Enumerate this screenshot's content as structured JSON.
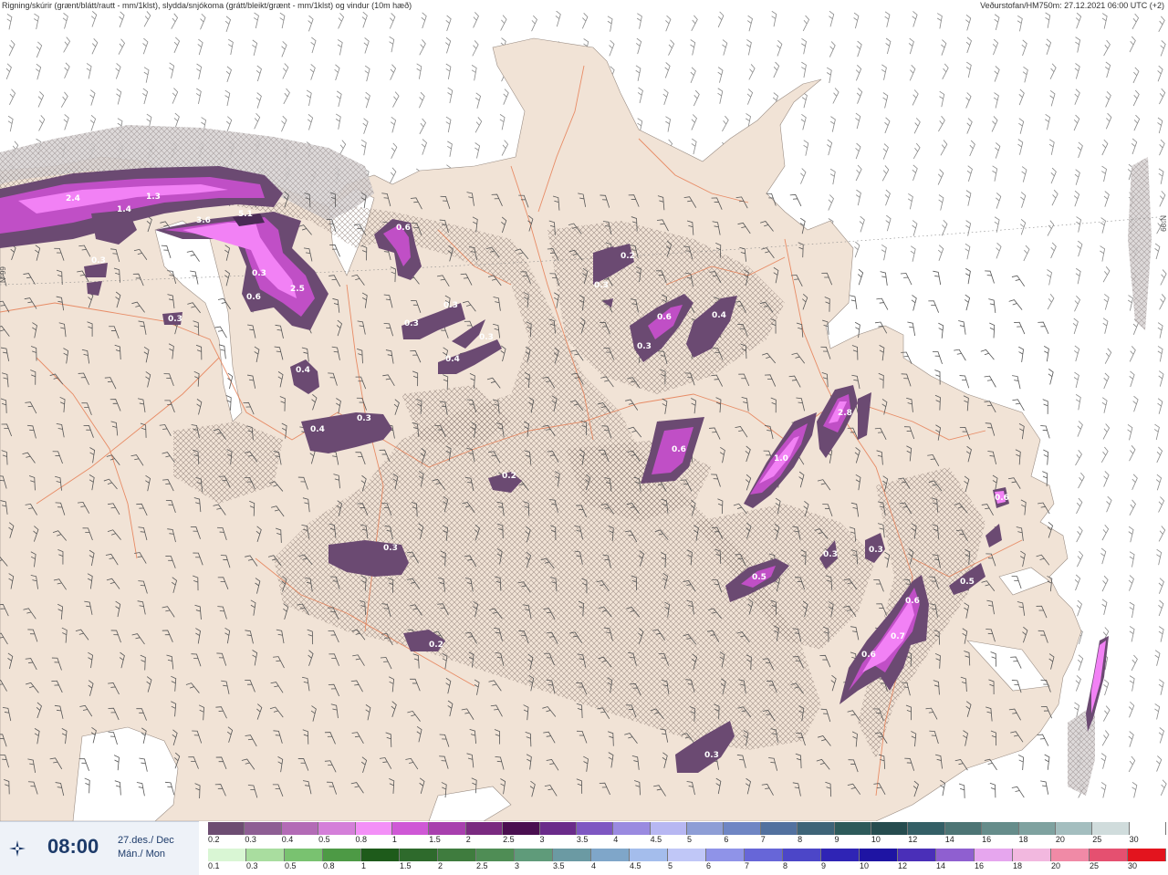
{
  "header": {
    "title": "Rigning/skúrir (grænt/blátt/rautt - mm/1klst), slydda/snjókoma (grátt/bleikt/grænt - mm/1klst) og vindur (10m hæð)",
    "source": "Veðurstofan/HM750m: 27.12.2021 06:00 UTC (+2)"
  },
  "timebox": {
    "icon": "crosshair-star-icon",
    "time": "08:00",
    "date_line1": "27.des./ Dec",
    "date_line2": "Mán./ Mon"
  },
  "map": {
    "lat_label_left": "N°99",
    "lat_label_right": "N°99",
    "colors": {
      "land": "#f1e3d6",
      "sea": "#ffffff",
      "roads": "#e67c52",
      "hatch": "#8b7a73",
      "cell_dark": "#6b4a72",
      "cell_mid": "#c04fc6",
      "cell_bright": "#f281f5"
    },
    "cells": [
      {
        "label": "2.4",
        "value": 2.4
      },
      {
        "label": "1.3",
        "value": 1.3
      },
      {
        "label": "1.4",
        "value": 1.4
      },
      {
        "label": "3.6",
        "value": 3.6
      },
      {
        "label": "5.1",
        "value": 5.1
      },
      {
        "label": "0.3",
        "value": 0.3
      },
      {
        "label": "0.3",
        "value": 0.3
      },
      {
        "label": "2.5",
        "value": 2.5
      },
      {
        "label": "0.6",
        "value": 0.6
      },
      {
        "label": "0.3",
        "value": 0.3
      },
      {
        "label": "0.6",
        "value": 0.6
      },
      {
        "label": "0.3",
        "value": 0.3
      },
      {
        "label": "0.3",
        "value": 0.3
      },
      {
        "label": "0.3",
        "value": 0.3
      },
      {
        "label": "0.4",
        "value": 0.4
      },
      {
        "label": "0.4",
        "value": 0.4
      },
      {
        "label": "0.4",
        "value": 0.4
      },
      {
        "label": "0.3",
        "value": 0.3
      },
      {
        "label": "0.2",
        "value": 0.2
      },
      {
        "label": "0.3",
        "value": 0.3
      },
      {
        "label": "0.6",
        "value": 0.6
      },
      {
        "label": "0.3",
        "value": 0.3
      },
      {
        "label": "0.4",
        "value": 0.4
      },
      {
        "label": "0.6",
        "value": 0.6
      },
      {
        "label": "1.0",
        "value": 1.0
      },
      {
        "label": "2.8",
        "value": 2.8
      },
      {
        "label": "0.2",
        "value": 0.2
      },
      {
        "label": "0.3",
        "value": 0.3
      },
      {
        "label": "0.2",
        "value": 0.2
      },
      {
        "label": "0.5",
        "value": 0.5
      },
      {
        "label": "0.3",
        "value": 0.3
      },
      {
        "label": "0.3",
        "value": 0.3
      },
      {
        "label": "0.6",
        "value": 0.6
      },
      {
        "label": "0.7",
        "value": 0.7
      },
      {
        "label": "0.6",
        "value": 0.6
      },
      {
        "label": "0.5",
        "value": 0.5
      },
      {
        "label": "0.6",
        "value": 0.6
      },
      {
        "label": "0.3",
        "value": 0.3
      }
    ]
  },
  "legend": {
    "snow": {
      "labels": [
        "0.2",
        "0.3",
        "0.4",
        "0.5",
        "0.8",
        "1",
        "1.5",
        "2",
        "2.5",
        "3",
        "3.5",
        "4",
        "4.5",
        "5",
        "6",
        "7",
        "8",
        "9",
        "10",
        "12",
        "14",
        "16",
        "18",
        "20",
        "25",
        "30"
      ],
      "colors": [
        "#6d4d72",
        "#8e5e94",
        "#b36bb6",
        "#d47fd9",
        "#f390f7",
        "#cf58d6",
        "#a83fae",
        "#7a2a80",
        "#4a0f50",
        "#6a2b8a",
        "#7e57c2",
        "#9a8ae0",
        "#b7b7f2",
        "#8e9ed6",
        "#6f86c4",
        "#52719f",
        "#3e6478",
        "#2d5a5a",
        "#264c4f",
        "#345f66",
        "#4d7575",
        "#668d8b",
        "#7fa2a0",
        "#a4bebf",
        "#d0dcdc",
        "#ffffff"
      ]
    },
    "rain": {
      "labels": [
        "0.1",
        "0.3",
        "0.5",
        "0.8",
        "1",
        "1.5",
        "2",
        "2.5",
        "3",
        "3.5",
        "4",
        "4.5",
        "5",
        "6",
        "7",
        "8",
        "9",
        "10",
        "12",
        "14",
        "16",
        "18",
        "20",
        "25",
        "30"
      ],
      "colors": [
        "#d9f6d4",
        "#a9dd9f",
        "#79c270",
        "#4d9a45",
        "#1e5b1b",
        "#2e6a2c",
        "#3f7c3e",
        "#4f8d55",
        "#5f9b7a",
        "#6b9aa3",
        "#7fa6c9",
        "#a4bdec",
        "#c0c7f7",
        "#8f93e8",
        "#6766d8",
        "#4c46c8",
        "#2f24b5",
        "#1e14a3",
        "#4a2fb8",
        "#8f5fd0",
        "#e6a6ee",
        "#f2b8df",
        "#f08aa6",
        "#e55070",
        "#e3141e"
      ]
    }
  }
}
